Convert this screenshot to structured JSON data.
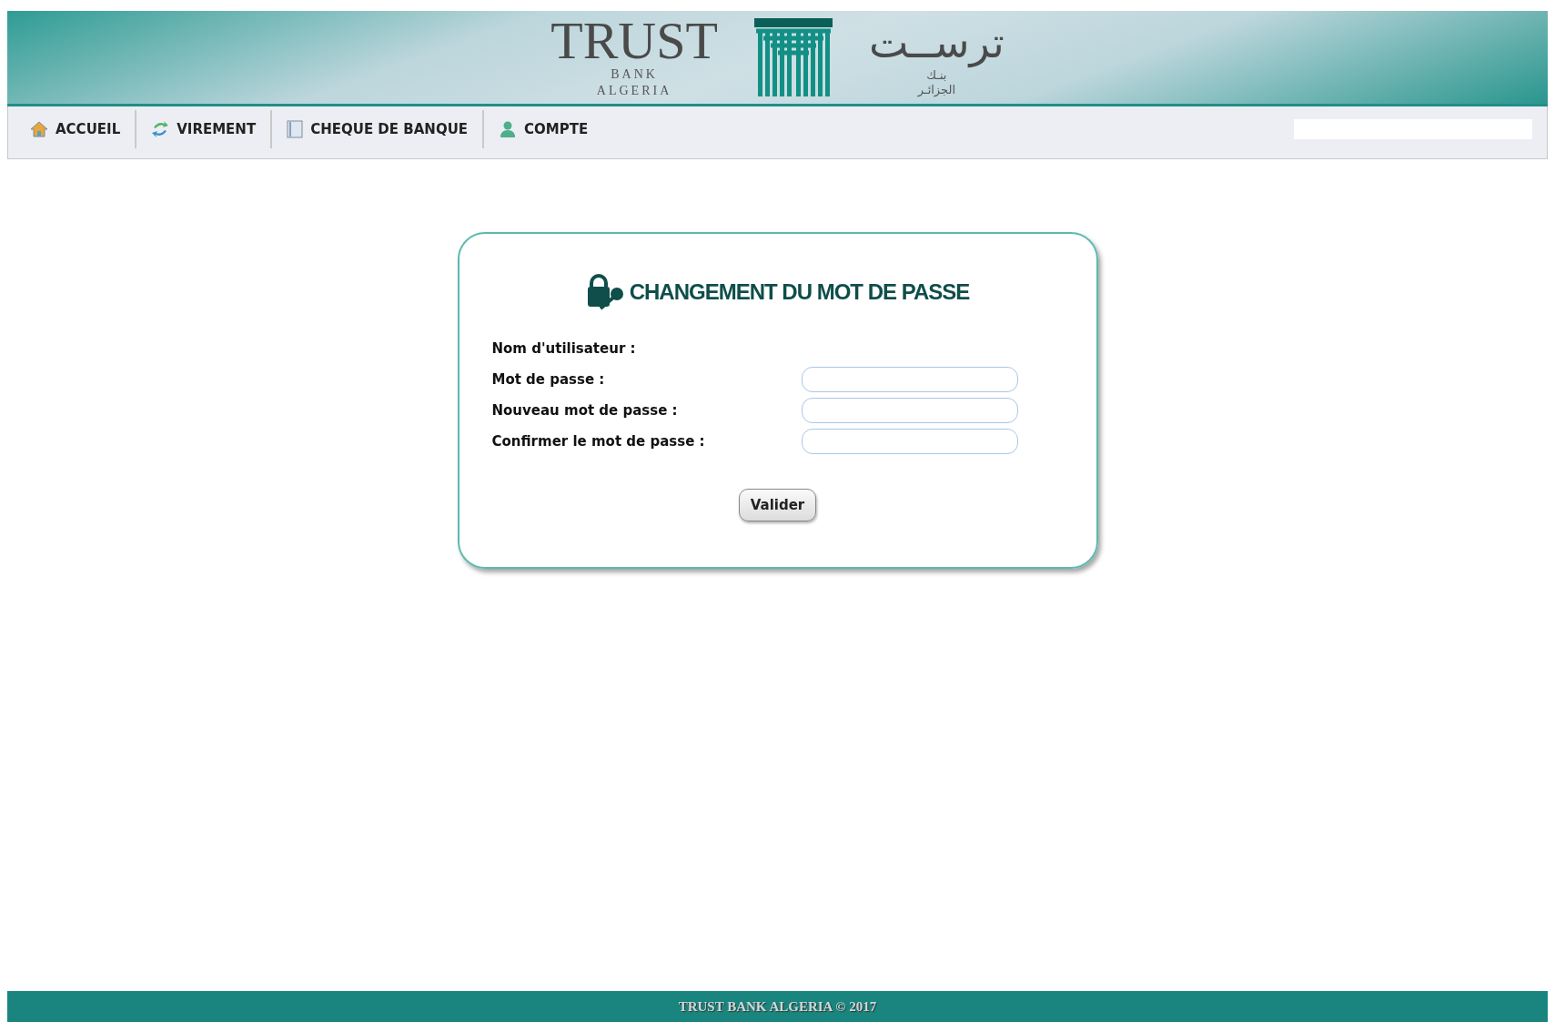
{
  "header": {
    "brand_latin": "TRUST",
    "brand_sub": [
      "BANK",
      "ALGERIA"
    ],
    "brand_arabic": "ترســت",
    "brand_arabic_sub": [
      "بنـك",
      "الجزائـر"
    ]
  },
  "nav": {
    "items": [
      {
        "label": "ACCUEIL",
        "kind": "home"
      },
      {
        "label": "VIREMENT",
        "kind": "transfer"
      },
      {
        "label": "CHEQUE DE BANQUE",
        "kind": "cheque"
      },
      {
        "label": "COMPTE",
        "kind": "account"
      }
    ]
  },
  "form": {
    "title": "CHANGEMENT DU MOT DE PASSE",
    "fields": [
      {
        "label": "Nom d'utilisateur :",
        "kind": "text"
      },
      {
        "label": "Mot de passe :",
        "kind": "input"
      },
      {
        "label": "Nouveau mot de passe :",
        "kind": "input"
      },
      {
        "label": "Confirmer le mot de passe :",
        "kind": "input"
      }
    ],
    "submit": "Valider"
  },
  "footer": "TRUST BANK ALGERIA © 2017"
}
